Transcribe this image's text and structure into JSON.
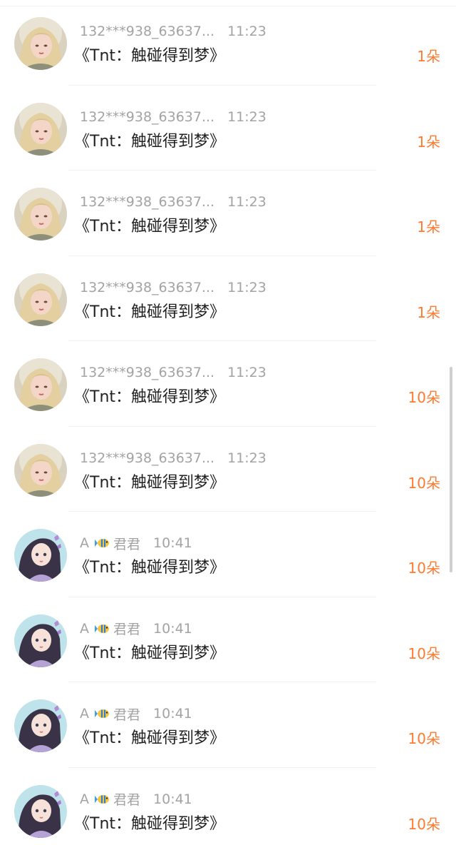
{
  "rows": [
    {
      "name": "132***938_63637...",
      "time": "11:23",
      "title": "《Tnt：触碰得到梦》",
      "amount": "1朵",
      "avatar": "blonde-woman-avatar"
    },
    {
      "name": "132***938_63637...",
      "time": "11:23",
      "title": "《Tnt：触碰得到梦》",
      "amount": "1朵",
      "avatar": "blonde-woman-avatar"
    },
    {
      "name": "132***938_63637...",
      "time": "11:23",
      "title": "《Tnt：触碰得到梦》",
      "amount": "1朵",
      "avatar": "blonde-woman-avatar"
    },
    {
      "name": "132***938_63637...",
      "time": "11:23",
      "title": "《Tnt：触碰得到梦》",
      "amount": "1朵",
      "avatar": "blonde-woman-avatar"
    },
    {
      "name": "132***938_63637...",
      "time": "11:23",
      "title": "《Tnt：触碰得到梦》",
      "amount": "10朵",
      "avatar": "blonde-woman-avatar"
    },
    {
      "name": "132***938_63637...",
      "time": "11:23",
      "title": "《Tnt：触碰得到梦》",
      "amount": "10朵",
      "avatar": "blonde-woman-avatar"
    },
    {
      "name_prefix": "A",
      "name_suffix": "君君",
      "emoji": "tropical-fish-icon",
      "time": "10:41",
      "title": "《Tnt：触碰得到梦》",
      "amount": "10朵",
      "avatar": "anime-girl-avatar"
    },
    {
      "name_prefix": "A",
      "name_suffix": "君君",
      "emoji": "tropical-fish-icon",
      "time": "10:41",
      "title": "《Tnt：触碰得到梦》",
      "amount": "10朵",
      "avatar": "anime-girl-avatar"
    },
    {
      "name_prefix": "A",
      "name_suffix": "君君",
      "emoji": "tropical-fish-icon",
      "time": "10:41",
      "title": "《Tnt：触碰得到梦》",
      "amount": "10朵",
      "avatar": "anime-girl-avatar"
    },
    {
      "name_prefix": "A",
      "name_suffix": "君君",
      "emoji": "tropical-fish-icon",
      "time": "10:41",
      "title": "《Tnt：触碰得到梦》",
      "amount": "10朵",
      "avatar": "anime-girl-avatar"
    }
  ],
  "colors": {
    "meta": "#a3a3a3",
    "title": "#222222",
    "amount": "#ff7a2e",
    "divider": "#f1f1f1"
  }
}
